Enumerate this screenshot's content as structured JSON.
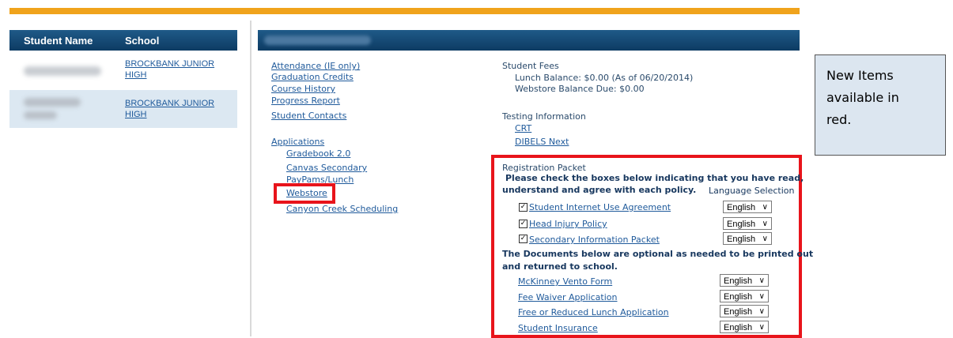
{
  "students_table": {
    "headers": {
      "name": "Student Name",
      "school": "School"
    },
    "rows": [
      {
        "school": "BROCKBANK JUNIOR HIGH"
      },
      {
        "school": "BROCKBANK JUNIOR HIGH"
      }
    ]
  },
  "links_col1": {
    "items": [
      "Attendance (IE only)",
      "Graduation Credits",
      "Course History",
      "Progress Report",
      "Student Contacts"
    ],
    "applications_heading": "Applications",
    "applications": [
      "Gradebook 2.0",
      "Canvas Secondary",
      "PayPams/Lunch",
      "Webstore",
      "Canyon Creek Scheduling"
    ]
  },
  "fees": {
    "heading": "Student Fees",
    "lunch": "Lunch Balance: $0.00 (As of 06/20/2014)",
    "webstore": "Webstore Balance Due: $0.00"
  },
  "testing": {
    "heading": "Testing Information",
    "links": [
      "CRT",
      "DIBELS Next"
    ]
  },
  "registration": {
    "heading": "Registration Packet",
    "instructions_line1": "Please check the boxes below indicating that you have read,",
    "instructions_line2": "understand and agree with each policy.",
    "language_label": "Language Selection",
    "required": [
      {
        "label": "Student Internet Use Agreement",
        "lang": "English",
        "checked": true
      },
      {
        "label": "Head Injury Policy",
        "lang": "English",
        "checked": true
      },
      {
        "label": "Secondary Information Packet",
        "lang": "English",
        "checked": true
      }
    ],
    "optional_line1": "The Documents below are optional as needed to be printed out",
    "optional_line2": "and returned to school.",
    "optional": [
      {
        "label": "McKinney Vento Form",
        "lang": "English"
      },
      {
        "label": "Fee Waiver Application",
        "lang": "English"
      },
      {
        "label": "Free or Reduced Lunch Application",
        "lang": "English"
      },
      {
        "label": "Student Insurance",
        "lang": "English"
      }
    ]
  },
  "callout": {
    "line1": "New Items",
    "line2": "available in",
    "line3": "red."
  },
  "colors": {
    "accent": "#f0a31c",
    "header": "#0d3b63",
    "highlight": "#e8141b",
    "link": "#1f5a9b"
  }
}
